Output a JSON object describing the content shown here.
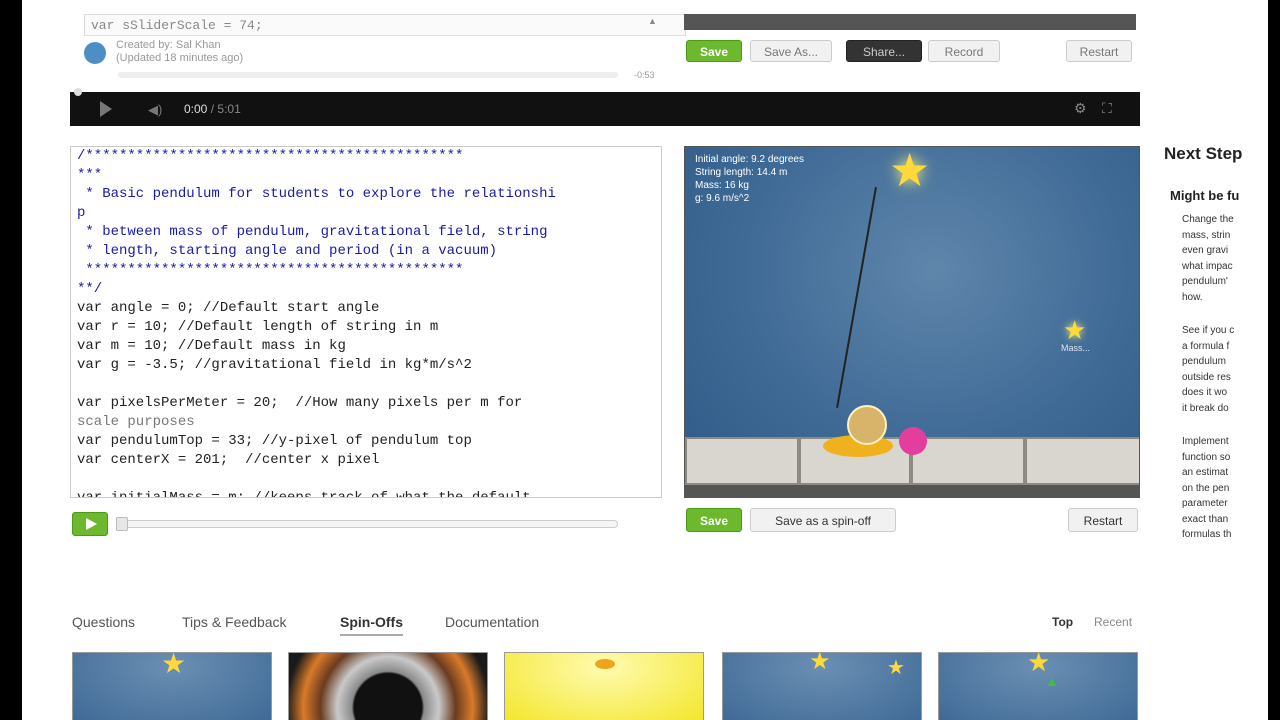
{
  "top_fragment": {
    "code_line": "var sSliderScale = 74;",
    "author": "Created by: Sal Khan",
    "updated": "(Updated 18 minutes ago)",
    "progress_time": "-0:53",
    "buttons": {
      "save": "Save",
      "save_as": "Save As...",
      "share": "Share...",
      "record": "Record",
      "restart": "Restart"
    }
  },
  "video": {
    "current_time": "0:00",
    "separator": "/",
    "total_time": "5:01"
  },
  "code": [
    "/*********************************************",
    "***",
    " * Basic pendulum for students to explore the relationshi",
    "p",
    " * between mass of pendulum, gravitational field, string",
    " * length, starting angle and period (in a vacuum)",
    " *********************************************",
    "**/",
    "var angle = 0; //Default start angle",
    "var r = 10; //Default length of string in m",
    "var m = 10; //Default mass in kg",
    "var g = -3.5; //gravitational field in kg*m/s^2",
    "",
    "var pixelsPerMeter = 20;  //How many pixels per m for",
    "scale purposes",
    "var pendulumTop = 33; //y-pixel of pendulum top",
    "var centerX = 201;  //center x pixel",
    "",
    "var initialMass = m; //keeps track of what the default"
  ],
  "canvas": {
    "initial_angle": "Initial angle:  9.2 degrees",
    "string_length": "String length: 14.4 m",
    "mass": "Mass: 16 kg",
    "gravity": "g: 9.6 m/s^2",
    "small_label": "Mass..."
  },
  "canvas_buttons": {
    "save": "Save",
    "spinoff": "Save as a spin-off",
    "restart": "Restart"
  },
  "sidebar": {
    "title": "Next Step",
    "subtitle": "Might be fu",
    "tips": [
      "Change the\nmass, strin\neven gravi\nwhat impac\npendulum'\nhow.",
      "See if you c\na formula f\npendulum\noutside res\ndoes it wo\nit break do",
      "Implement\nfunction so\nan estimat\non the pen\nparameter\nexact than\nformulas th"
    ]
  },
  "tabs": [
    "Questions",
    "Tips & Feedback",
    "Spin-Offs",
    "Documentation"
  ],
  "active_tab": "Spin-Offs",
  "sort": {
    "top": "Top",
    "recent": "Recent"
  },
  "colors": {
    "accent_green": "#6cb92d",
    "code_blue": "#1a1aa6",
    "sky_blue": "#3f6a96",
    "star_yellow": "#ffd93a"
  }
}
